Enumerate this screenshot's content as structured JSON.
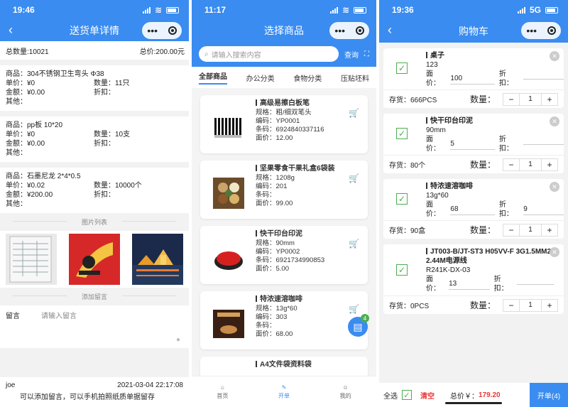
{
  "p1": {
    "time": "19:46",
    "title": "送货单详情",
    "total_qty": "总数量:10021",
    "total_price": "总价:200.00元",
    "items": [
      {
        "name": "商品：304不锈钢卫生弯头 Φ38",
        "unit": "单价：¥0",
        "qty": "数量：11只",
        "amount": "金额：¥0.00",
        "discount": "折扣：",
        "other": "其他："
      },
      {
        "name": "商品：pp板 10*20",
        "unit": "单价：¥0",
        "qty": "数量：10支",
        "amount": "金额：¥0.00",
        "discount": "折扣：",
        "other": "其他："
      },
      {
        "name": "商品：石墨尼龙 2*4*0.5",
        "unit": "单价：¥0.02",
        "qty": "数量：10000个",
        "amount": "金额：¥200.00",
        "discount": "折扣：",
        "other": "其他："
      }
    ],
    "images_header": "图片列表",
    "msg_header": "添加留言",
    "msg_label": "留言",
    "msg_placeholder": "请输入留言",
    "footer_user": "joe",
    "footer_time": "2021-03-04 22:17:08",
    "footer_note": "可以添加留言，可以手机拍照纸质单据留存"
  },
  "p2": {
    "time": "11:17",
    "title": "选择商品",
    "search_placeholder": "请输入搜索内容",
    "query": "查询",
    "tabs": [
      "全部商品",
      "办公分类",
      "食物分类",
      "压贴坯料"
    ],
    "products": [
      {
        "title": "高级易擦白板笔",
        "l1": "规格：粗/细双笔头",
        "l2": "编码：YP0001",
        "l3": "条码：6924840337116",
        "l4": "面价：12.00"
      },
      {
        "title": "坚果零食干果礼盒6袋装",
        "l1": "规格：1208g",
        "l2": "编码：201",
        "l3": "条码：",
        "l4": "面价：99.00"
      },
      {
        "title": "快干印台印泥",
        "l1": "规格：90mm",
        "l2": "编码：YP0002",
        "l3": "条码：6921734990853",
        "l4": "面价：5.00"
      },
      {
        "title": "特浓速溶咖啡",
        "l1": "规格：13g*60",
        "l2": "编码：303",
        "l3": "条码：",
        "l4": "面价：68.00"
      },
      {
        "title": "A4文件袋资料袋",
        "l1": "",
        "l2": "",
        "l3": "",
        "l4": ""
      }
    ],
    "fab_badge": "4",
    "tabbar": [
      "首页",
      "开单",
      "我的"
    ]
  },
  "p3": {
    "time": "19:36",
    "network": "5G",
    "title": "购物车",
    "items": [
      {
        "title": "桌子",
        "sub": "123",
        "price_label": "面价：",
        "price": "100",
        "discount_label": "折扣：",
        "discount": "",
        "stock": "存货：666PCS",
        "qty_label": "数量：",
        "qty": "1"
      },
      {
        "title": "快干印台印泥",
        "sub": "90mm",
        "price_label": "面价：",
        "price": "5",
        "discount_label": "折扣：",
        "discount": "",
        "stock": "存货：80个",
        "qty_label": "数量：",
        "qty": "1"
      },
      {
        "title": "特浓速溶咖啡",
        "sub": "13g*60",
        "price_label": "面价：",
        "price": "68",
        "discount_label": "折扣：",
        "discount": "9",
        "stock": "存货：90盒",
        "qty_label": "数量：",
        "qty": "1"
      },
      {
        "title": "JT003-B/JT-ST3 H05VV-F 3G1.5MM2 2.44M电源线",
        "sub": "R241K-DX-03",
        "price_label": "面价：",
        "price": "13",
        "discount_label": "折扣：",
        "discount": "",
        "stock": "存货：0PCS",
        "qty_label": "数量：",
        "qty": "1"
      }
    ],
    "select_all": "全选",
    "clear": "清空",
    "total_label": "总价￥：",
    "total": "179.20",
    "checkout": "开单(4)"
  },
  "colors": {
    "primary": "#3a8cf0",
    "check": "#4caf50",
    "danger": "#e53935"
  }
}
